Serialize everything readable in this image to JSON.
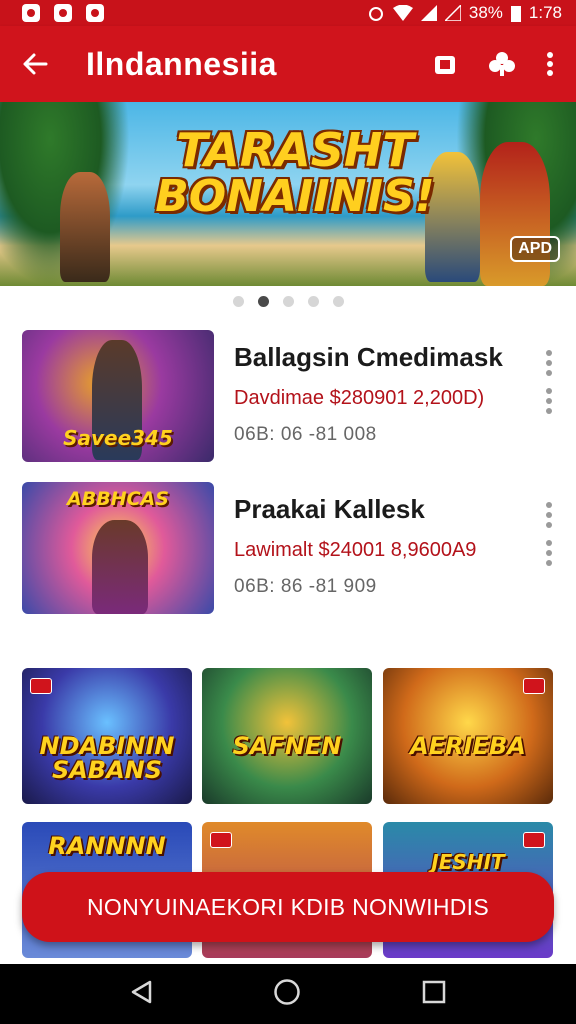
{
  "status_bar": {
    "battery": "38%",
    "time": "1:78"
  },
  "app_bar": {
    "title": "Ilndannesiia"
  },
  "hero": {
    "line1": "TARASHT",
    "line2": "BONAIINIS!",
    "badge": "APD"
  },
  "carousel": {
    "count": 5,
    "active_index": 1
  },
  "list": [
    {
      "name": "Ballagsin Cmedimask",
      "price": "Davdimae $280901 2,200D)",
      "meta": "06B: 06   -81 008",
      "thumb_caption": "Savee345",
      "thumb_top_caption": ""
    },
    {
      "name": "Praakai Kallesk",
      "price": "Lawimalt $24001 8,9600A9",
      "meta": "06B: 86   -81 909",
      "thumb_caption": "",
      "thumb_top_caption": "ABBHCAS"
    }
  ],
  "grid": [
    {
      "caption": "NDABININ SABANS"
    },
    {
      "caption": "SAFNEN"
    },
    {
      "caption": "AERIEBA"
    },
    {
      "caption": "RANNNN"
    },
    {
      "caption": ""
    },
    {
      "caption": "JESHIT"
    }
  ],
  "cta": {
    "label": "NONYUINAEKORI KDIB NONWIHDIS"
  },
  "colors": {
    "brand_red": "#d0141c",
    "cta_red": "#cf1219",
    "price_red": "#b3121a"
  }
}
